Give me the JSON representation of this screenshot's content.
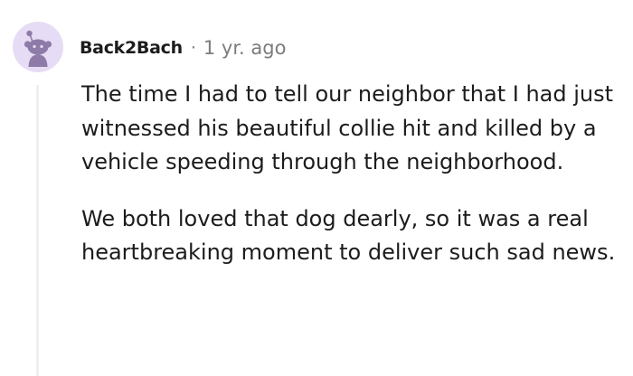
{
  "comment": {
    "author": "Back2Bach",
    "separator": "·",
    "time_ago": "1 yr. ago",
    "avatar_icon": "snoo-avatar-icon",
    "paragraphs": [
      "The time I had to tell our neighbor that I had just witnessed his beautiful collie hit and killed by a vehicle speeding through the neighborhood.",
      "We both loved that dog dearly, so it was a real heartbreaking moment to deliver such sad news."
    ]
  },
  "colors": {
    "avatar_bg": "#e6dcf5",
    "avatar_figure": "#8e7ba8",
    "meta_text": "#7c7c7c",
    "thread_line": "#edeff1"
  }
}
